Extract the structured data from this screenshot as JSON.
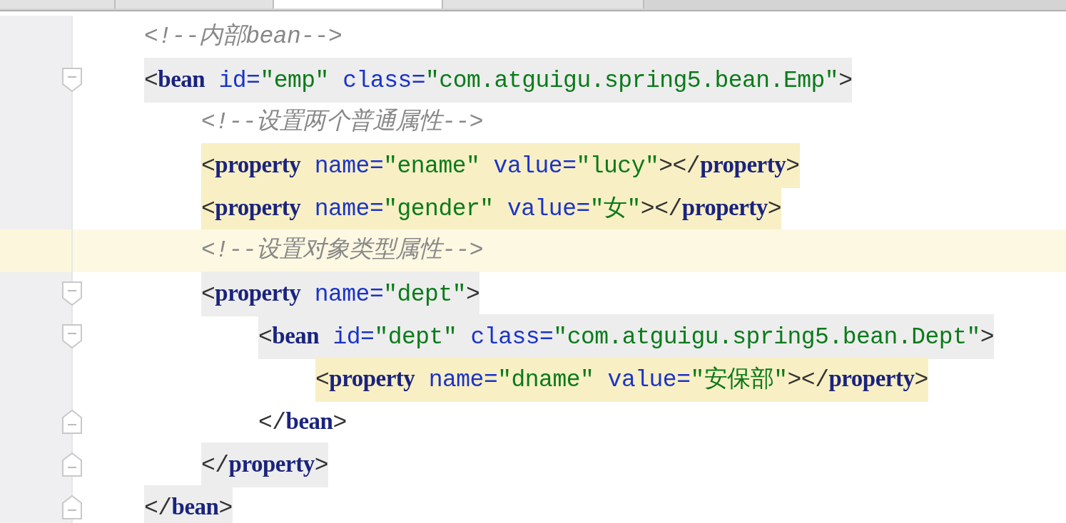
{
  "tabs": [
    {
      "selected": false
    },
    {
      "selected": false
    },
    {
      "selected": true
    },
    {
      "selected": false
    }
  ],
  "lines": [
    {
      "fold_start": false,
      "tag_highlight": false,
      "match_highlight": false,
      "current": false,
      "tokens": [
        {
          "kind": "comment",
          "text": "<!--内部bean-->"
        }
      ]
    },
    {
      "fold_start": true,
      "tag_highlight": true,
      "match_highlight": false,
      "current": false,
      "tokens": [
        {
          "kind": "bracket",
          "text": "<"
        },
        {
          "kind": "tag",
          "text": "bean"
        },
        {
          "kind": "attr",
          "text": " id="
        },
        {
          "kind": "value",
          "text": "\"emp\""
        },
        {
          "kind": "attr",
          "text": " class="
        },
        {
          "kind": "value",
          "text": "\"com.atguigu.spring5.bean.Emp\""
        },
        {
          "kind": "bracket",
          "text": ">"
        }
      ],
      "children": [
        {
          "fold_start": false,
          "tag_highlight": false,
          "match_highlight": false,
          "current": false,
          "tokens": [
            {
              "kind": "comment",
              "text": "<!--设置两个普通属性-->"
            }
          ]
        },
        {
          "fold_start": false,
          "tag_highlight": false,
          "match_highlight": true,
          "current": false,
          "tokens": [
            {
              "kind": "bracket",
              "text": "<"
            },
            {
              "kind": "tag",
              "text": "property"
            },
            {
              "kind": "attr",
              "text": " name="
            },
            {
              "kind": "value",
              "text": "\"ename\""
            },
            {
              "kind": "attr",
              "text": " value="
            },
            {
              "kind": "value",
              "text": "\"lucy\""
            },
            {
              "kind": "bracket",
              "text": "></"
            },
            {
              "kind": "tag",
              "text": "property"
            },
            {
              "kind": "bracket",
              "text": ">"
            }
          ]
        },
        {
          "fold_start": false,
          "tag_highlight": false,
          "match_highlight": true,
          "current": false,
          "tokens": [
            {
              "kind": "bracket",
              "text": "<"
            },
            {
              "kind": "tag",
              "text": "property"
            },
            {
              "kind": "attr",
              "text": " name="
            },
            {
              "kind": "value",
              "text": "\"gender\""
            },
            {
              "kind": "attr",
              "text": " value="
            },
            {
              "kind": "value",
              "text": "\"女\""
            },
            {
              "kind": "bracket",
              "text": "></"
            },
            {
              "kind": "tag",
              "text": "property"
            },
            {
              "kind": "bracket",
              "text": ">"
            }
          ]
        },
        {
          "fold_start": false,
          "tag_highlight": false,
          "match_highlight": false,
          "current": true,
          "tokens": [
            {
              "kind": "comment",
              "text": "<!--设置对象类型属性-->"
            }
          ]
        },
        {
          "fold_start": true,
          "tag_highlight": true,
          "match_highlight": false,
          "current": false,
          "tokens": [
            {
              "kind": "bracket",
              "text": "<"
            },
            {
              "kind": "tag",
              "text": "property"
            },
            {
              "kind": "attr",
              "text": " name="
            },
            {
              "kind": "value",
              "text": "\"dept\""
            },
            {
              "kind": "bracket",
              "text": ">"
            }
          ],
          "children": [
            {
              "fold_start": true,
              "tag_highlight": true,
              "match_highlight": false,
              "current": false,
              "tokens": [
                {
                  "kind": "bracket",
                  "text": "<"
                },
                {
                  "kind": "tag",
                  "text": "bean"
                },
                {
                  "kind": "attr",
                  "text": " id="
                },
                {
                  "kind": "value",
                  "text": "\"dept\""
                },
                {
                  "kind": "attr",
                  "text": " class="
                },
                {
                  "kind": "value",
                  "text": "\"com.atguigu.spring5.bean.Dept\""
                },
                {
                  "kind": "bracket",
                  "text": ">"
                }
              ],
              "children": [
                {
                  "fold_start": false,
                  "tag_highlight": false,
                  "match_highlight": true,
                  "current": false,
                  "tokens": [
                    {
                      "kind": "bracket",
                      "text": "<"
                    },
                    {
                      "kind": "tag",
                      "text": "property"
                    },
                    {
                      "kind": "attr",
                      "text": " name="
                    },
                    {
                      "kind": "value",
                      "text": "\"dname\""
                    },
                    {
                      "kind": "attr",
                      "text": " value="
                    },
                    {
                      "kind": "value",
                      "text": "\"安保部\""
                    },
                    {
                      "kind": "bracket",
                      "text": "></"
                    },
                    {
                      "kind": "tag",
                      "text": "property"
                    },
                    {
                      "kind": "bracket",
                      "text": ">"
                    }
                  ]
                }
              ],
              "closing": {
                "tag_highlight": false,
                "tokens": [
                  {
                    "kind": "bracket",
                    "text": "</"
                  },
                  {
                    "kind": "tag",
                    "text": "bean"
                  },
                  {
                    "kind": "bracket",
                    "text": ">"
                  }
                ]
              }
            }
          ],
          "closing": {
            "tag_highlight": true,
            "tokens": [
              {
                "kind": "bracket",
                "text": "</"
              },
              {
                "kind": "tag",
                "text": "property"
              },
              {
                "kind": "bracket",
                "text": ">"
              }
            ]
          }
        }
      ],
      "closing": {
        "tag_highlight": true,
        "tokens": [
          {
            "kind": "bracket",
            "text": "</"
          },
          {
            "kind": "tag",
            "text": "bean"
          },
          {
            "kind": "bracket",
            "text": ">"
          }
        ]
      }
    }
  ]
}
